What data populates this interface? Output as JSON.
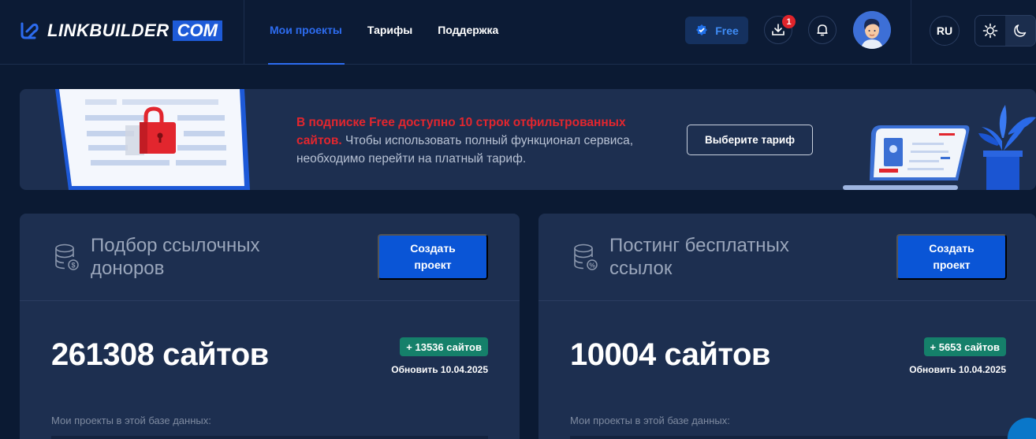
{
  "header": {
    "logo_main": "LINKBUILDER",
    "logo_suffix": "COM",
    "nav": [
      {
        "label": "Мои проекты",
        "active": true
      },
      {
        "label": "Тарифы",
        "active": false
      },
      {
        "label": "Поддержка",
        "active": false
      }
    ],
    "plan_label": "Free",
    "downloads_count": "1",
    "language": "RU",
    "theme": "dark"
  },
  "banner": {
    "highlight_text": "В подписке Free доступно 10 строк отфильтрованных сайтов.",
    "body_text": " Чтобы использовать полный функционал сервиса, необходимо перейти на платный тариф.",
    "button_label": "Выберите тариф"
  },
  "cards": [
    {
      "title": "Подбор ссылочных доноров",
      "icon": "database-dollar-icon",
      "button_label": "Создать проект",
      "count_text": "261308 сайтов",
      "delta": "+ 13536 сайтов",
      "updated": "Обновить 10.04.2025",
      "projects_label": "Мои проекты в этой базе данных:"
    },
    {
      "title": "Постинг бесплатных ссылок",
      "icon": "database-percent-icon",
      "button_label": "Создать проект",
      "count_text": "10004 сайтов",
      "delta": "+ 5653 сайтов",
      "updated": "Обновить 10.04.2025",
      "projects_label": "Мои проекты в этой базе данных:"
    }
  ],
  "colors": {
    "background": "#0b1a33",
    "surface": "#1d2f50",
    "accent": "#0a55d6",
    "active_nav": "#2d6cf0",
    "success": "#15806a",
    "alert": "#e2262e"
  }
}
